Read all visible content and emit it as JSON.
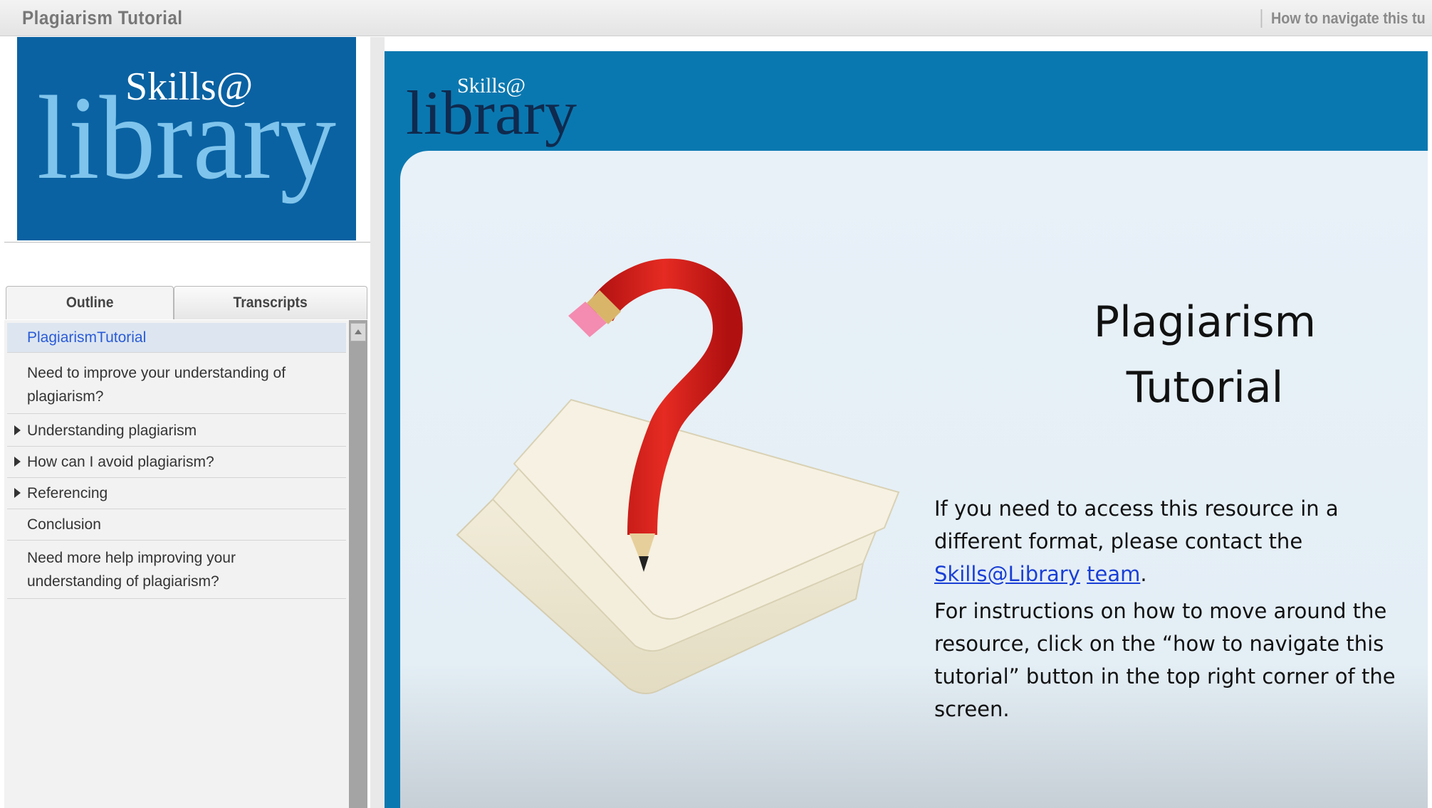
{
  "header": {
    "app_title": "Plagiarism Tutorial",
    "nav_link": "How to navigate this tutorial"
  },
  "sidebar": {
    "logo": {
      "top_text": "Skills@",
      "bottom_text": "library"
    },
    "tabs": [
      {
        "label": "Outline",
        "active": true
      },
      {
        "label": "Transcripts",
        "active": false
      }
    ],
    "outline": [
      {
        "label": "PlagiarismTutorial",
        "selected": true,
        "expandable": false
      },
      {
        "label_line1": "Need to improve your understanding of",
        "label_line2": "plagiarism?",
        "expandable": false
      },
      {
        "label": "Understanding plagiarism",
        "expandable": true
      },
      {
        "label": "How can I avoid plagiarism?",
        "expandable": true
      },
      {
        "label": "Referencing",
        "expandable": true
      },
      {
        "label": "Conclusion",
        "expandable": false
      },
      {
        "label_line1": "Need more help improving your",
        "label_line2": "understanding of plagiarism?",
        "expandable": false
      }
    ]
  },
  "slide": {
    "logo": {
      "top_text": "Skills@",
      "bottom_text": "library"
    },
    "title_line1": "Plagiarism",
    "title_line2": "Tutorial",
    "para1_text": "If you need to access this resource in a different format, please contact the ",
    "para1_link1": "Skills@Library",
    "para1_link2": "team",
    "para1_end": ".",
    "para2_text": "For instructions on how to  move around the resource, click on the “how to navigate this tutorial” button in the top right corner of the screen."
  },
  "colors": {
    "logo_bg": "#0a62a2",
    "slide_bg": "#0a78b0",
    "card_bg": "#e8f1f8",
    "link": "#1a3fd6",
    "selected_item": "#2a5bd7"
  }
}
